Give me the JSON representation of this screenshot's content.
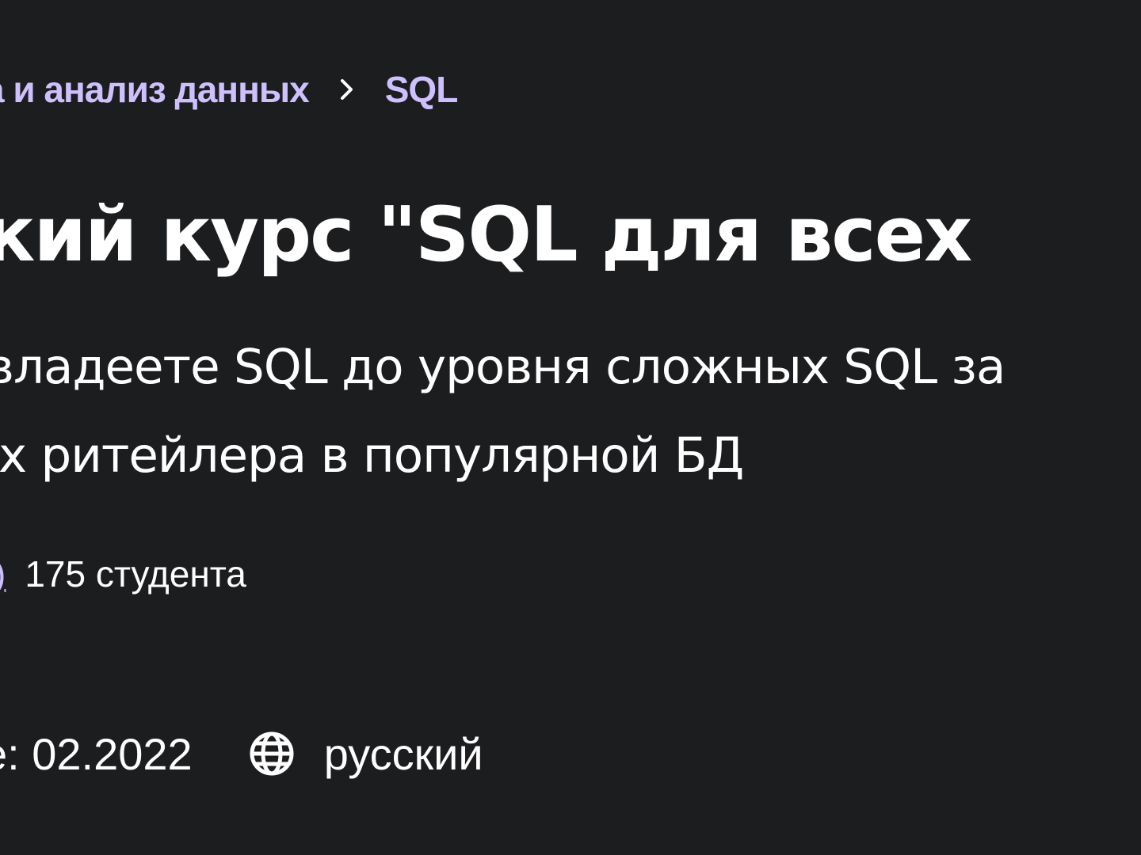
{
  "breadcrumb": {
    "items": [
      {
        "label": "а и анализ данных"
      },
      {
        "label": "SQL"
      }
    ]
  },
  "course": {
    "title": "кий курс \"SQL для всех",
    "subtitle_lines": [
      "владеете SQL до уровня сложных SQL за",
      "х ритейлера в популярной БД"
    ],
    "rating_count": ")",
    "students": "175 студента",
    "updated": "е: 02.2022",
    "language": "русский"
  },
  "colors": {
    "background": "#1c1d1f",
    "accent": "#cec0fc",
    "text": "#ffffff"
  },
  "icons": {
    "breadcrumb_separator": "chevron-right-icon",
    "language": "globe-icon"
  }
}
